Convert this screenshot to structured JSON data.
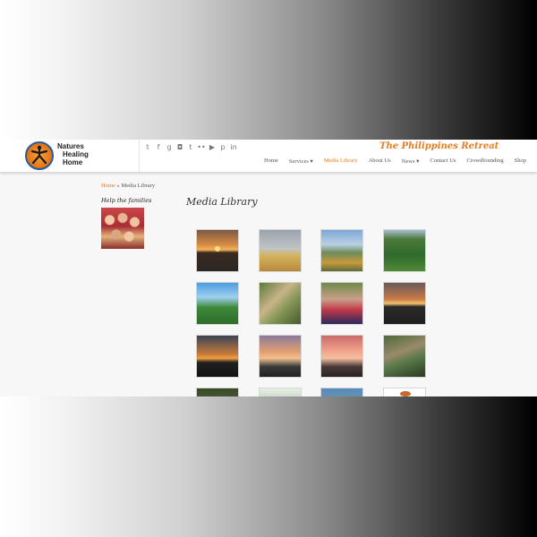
{
  "header": {
    "logo_lines": [
      "Natures",
      "Healing",
      "Home"
    ],
    "tagline": "The Philippines Retreat",
    "social_icons": [
      "twitter-icon",
      "facebook-icon",
      "google-plus-icon",
      "instagram-icon",
      "tumblr-icon",
      "flickr-icon",
      "youtube-icon",
      "pinterest-icon",
      "linkedin-icon"
    ],
    "social_glyphs": [
      "𝕥",
      "f",
      "g",
      "◘",
      "t",
      "••",
      "▶",
      "p",
      "in"
    ],
    "nav": [
      {
        "label": "Home",
        "active": false
      },
      {
        "label": "Services ▾",
        "active": false
      },
      {
        "label": "Media Library",
        "active": true
      },
      {
        "label": "About Us",
        "active": false
      },
      {
        "label": "News ▾",
        "active": false
      },
      {
        "label": "Contact Us",
        "active": false
      },
      {
        "label": "Crowdfounding",
        "active": false
      },
      {
        "label": "Shop",
        "active": false
      }
    ]
  },
  "breadcrumb": {
    "home": "Home",
    "separator": " » ",
    "current": "Media Library"
  },
  "sidebar": {
    "title": "Help the families"
  },
  "main": {
    "title": "Media Library",
    "thumbnails": [
      "sunset-over-hills",
      "field-with-buildings",
      "valley-landscape",
      "green-mountains",
      "tree-and-house",
      "man-by-rocks",
      "family-group",
      "orange-sunset",
      "dusk-sky",
      "sunset-clouds",
      "pink-sunset",
      "rocky-stream",
      "garden",
      "white-building",
      "trees",
      "logo-graphic"
    ]
  },
  "colors": {
    "accent": "#e57d20",
    "text": "#555555",
    "logo_ring": "#2a5a9a"
  }
}
